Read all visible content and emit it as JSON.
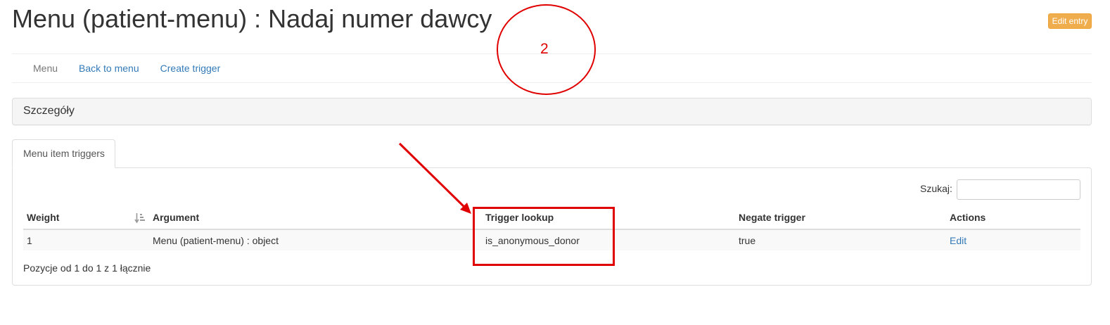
{
  "header": {
    "title": "Menu (patient-menu) : Nadaj numer dawcy",
    "edit_entry_label": "Edit entry"
  },
  "nav": {
    "items": [
      {
        "label": "Menu",
        "active": true
      },
      {
        "label": "Back to menu",
        "active": false
      },
      {
        "label": "Create trigger",
        "active": false
      }
    ]
  },
  "details": {
    "title": "Szczegóły"
  },
  "tabs": [
    {
      "label": "Menu item triggers",
      "active": true
    }
  ],
  "search": {
    "label": "Szukaj:",
    "value": "",
    "placeholder": ""
  },
  "table": {
    "columns": [
      "Weight",
      "Argument",
      "Trigger lookup",
      "Negate trigger",
      "Actions"
    ],
    "rows": [
      {
        "weight": "1",
        "argument": "Menu (patient-menu) : object",
        "trigger_lookup": "is_anonymous_donor",
        "negate_trigger": "true",
        "action": "Edit"
      }
    ],
    "info": "Pozycje od 1 do 1 z 1 łącznie"
  },
  "annotations": {
    "step_number": "2",
    "color": "#e00000"
  },
  "colors": {
    "link": "#337ab7",
    "warning_button": "#f0ad4e",
    "panel_bg": "#f5f5f5",
    "stripe_bg": "#f9f9f9"
  }
}
